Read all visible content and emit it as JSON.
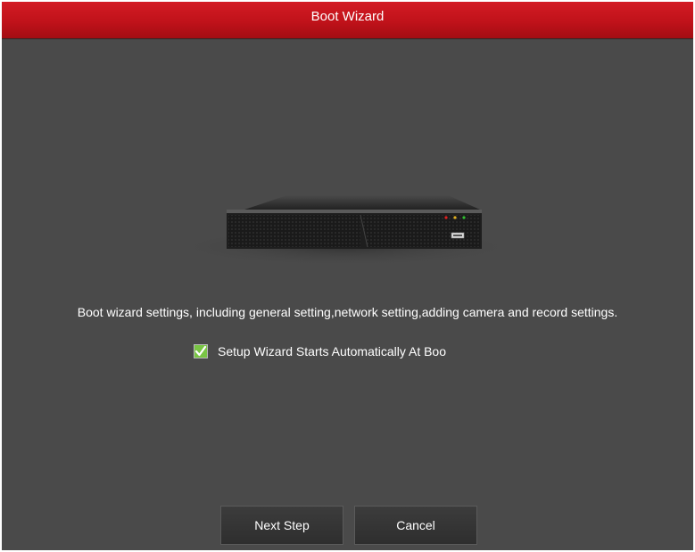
{
  "window": {
    "title": "Boot Wizard"
  },
  "content": {
    "device_image": "nvr-device-image",
    "description": "Boot wizard settings, including general setting,network setting,adding camera and record settings.",
    "auto_start_checkbox": {
      "checked": true,
      "label": "Setup Wizard Starts Automatically At Boo"
    }
  },
  "buttons": {
    "next_label": "Next Step",
    "cancel_label": "Cancel"
  },
  "colors": {
    "titlebar": "#c0121a",
    "background": "#4a4a4a",
    "button": "#333333",
    "check_green": "#6abf2a"
  }
}
